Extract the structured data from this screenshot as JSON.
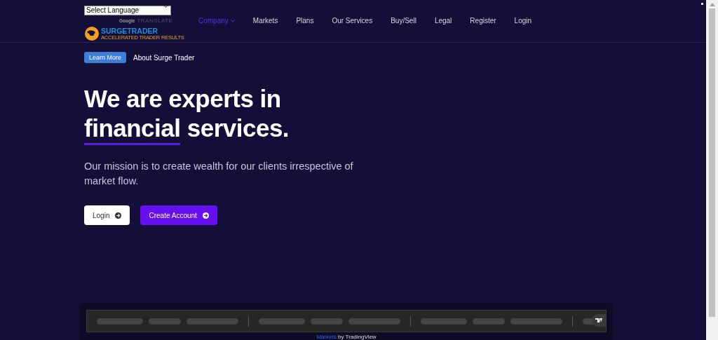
{
  "language_select": {
    "value": "Select Language"
  },
  "translate_credit": {
    "brand": "Google",
    "label": "TRANSLATE"
  },
  "logo": {
    "name_part_1": "SURGE",
    "name_part_2": "TRADER",
    "tagline": "ACCELERATED TRADER RESULTS"
  },
  "nav": [
    {
      "label": "Company",
      "selected": true,
      "dropdown": true
    },
    {
      "label": "Markets",
      "selected": false,
      "dropdown": false
    },
    {
      "label": "Plans",
      "selected": false,
      "dropdown": false
    },
    {
      "label": "Our Services",
      "selected": false,
      "dropdown": false
    },
    {
      "label": "Buy/Sell",
      "selected": false,
      "dropdown": false
    },
    {
      "label": "Legal",
      "selected": false,
      "dropdown": false
    },
    {
      "label": "Register",
      "selected": false,
      "dropdown": false
    },
    {
      "label": "Login",
      "selected": false,
      "dropdown": false
    }
  ],
  "badge": {
    "label": "Learn More",
    "text": "About Surge Trader"
  },
  "hero": {
    "heading_line_1": "We are experts in",
    "heading_word_underlined": "financial",
    "heading_rest": "services.",
    "text": "Our mission is to create wealth for our clients irrespective of market flow."
  },
  "buttons": [
    {
      "label": "Login",
      "kind": "outline"
    },
    {
      "label": "Create Account",
      "kind": "primary"
    }
  ],
  "ticker": {
    "link": "Markets",
    "credit": "by TradingView"
  }
}
